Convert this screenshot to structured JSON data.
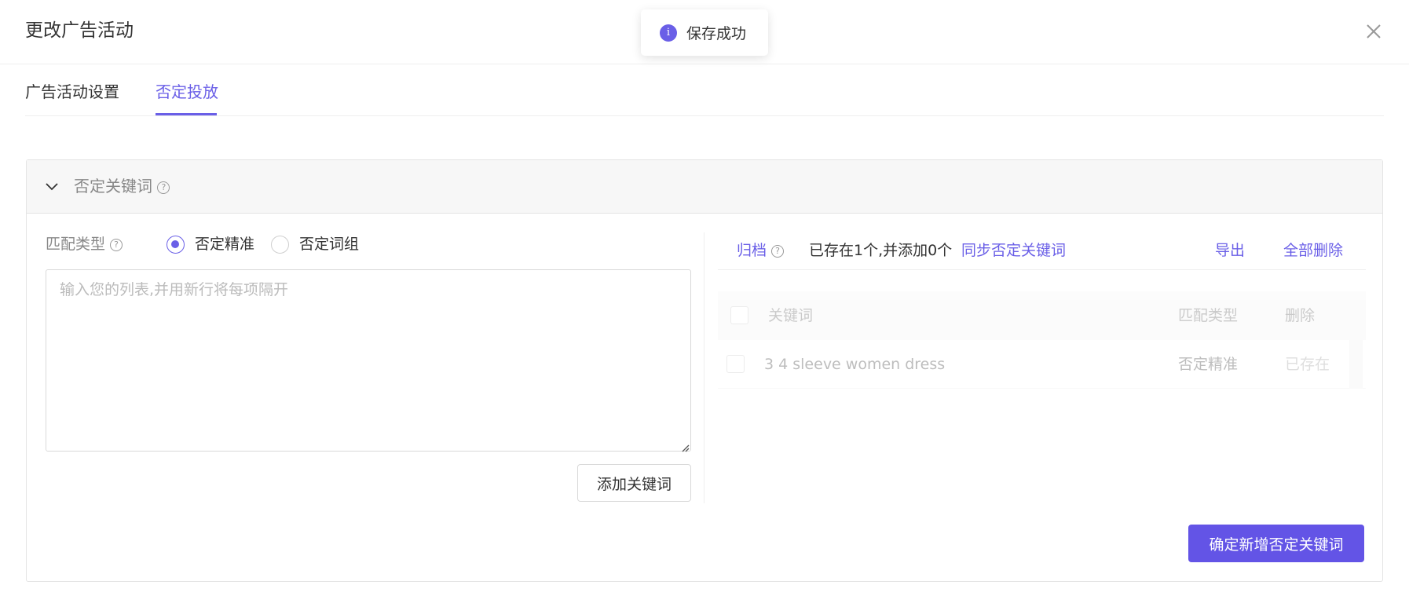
{
  "dialog": {
    "title": "更改广告活动"
  },
  "toast": {
    "icon": "info-icon",
    "icon_glyph": "i",
    "text": "保存成功"
  },
  "tabs": [
    {
      "label": "广告活动设置",
      "active": false
    },
    {
      "label": "否定投放",
      "active": true
    }
  ],
  "panel": {
    "title": "否定关键词",
    "help_glyph": "?",
    "left": {
      "match_type_label": "匹配类型",
      "options": [
        {
          "label": "否定精准",
          "checked": true
        },
        {
          "label": "否定词组",
          "checked": false
        }
      ],
      "textarea_placeholder": "输入您的列表,并用新行将每项隔开",
      "textarea_value": "",
      "add_button": "添加关键词"
    },
    "right": {
      "archive_label": "归档",
      "status_text": "已存在1个,并添加0个",
      "sync_link": "同步否定关键词",
      "export_link": "导出",
      "delete_all_link": "全部删除",
      "table": {
        "headers": [
          "关键词",
          "匹配类型",
          "删除"
        ],
        "rows": [
          {
            "keyword": "3 4 sleeve women dress",
            "match_type": "否定精准",
            "action": "已存在"
          }
        ]
      }
    },
    "confirm_button": "确定新增否定关键词"
  },
  "colors": {
    "accent": "#6a5fe7",
    "button_primary": "#6354e6"
  }
}
